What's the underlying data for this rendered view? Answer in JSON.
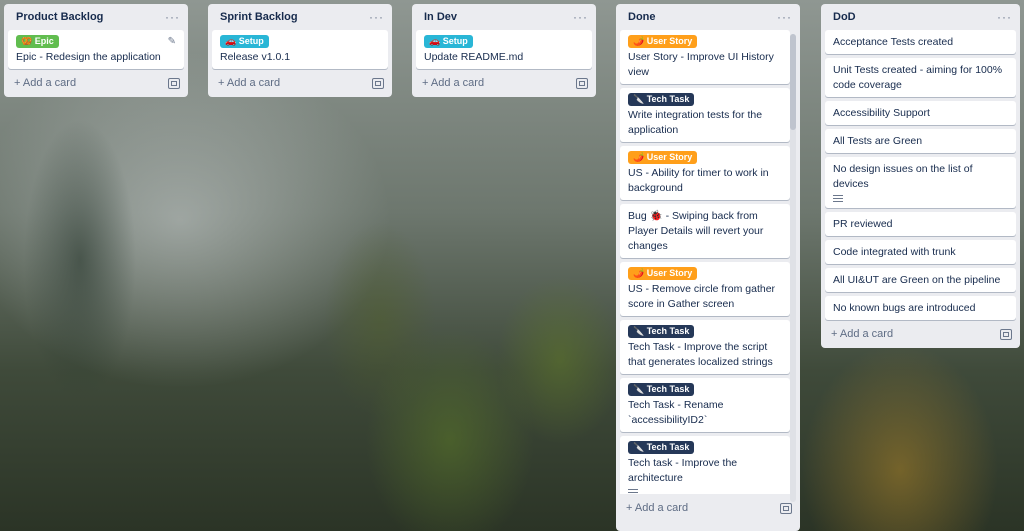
{
  "add_card_label": "Add a card",
  "menu_glyph": "···",
  "lists": [
    {
      "title": "Product Backlog",
      "cards": [
        {
          "label": "🥨 Epic",
          "title": "Epic - Redesign the application"
        }
      ]
    },
    {
      "title": "Sprint Backlog",
      "cards": [
        {
          "label": "🚗 Setup",
          "title": "Release v1.0.1"
        }
      ]
    },
    {
      "title": "In Dev",
      "cards": [
        {
          "label": "🚗 Setup",
          "title": "Update README.md"
        }
      ]
    },
    {
      "title": "Done",
      "cards": [
        {
          "label": "🌶️ User Story",
          "title": "User Story - Improve UI History view"
        },
        {
          "label": "🔪 Tech Task",
          "title": "Write integration tests for the application"
        },
        {
          "label": "🌶️ User Story",
          "title": "US - Ability for timer to work in background"
        },
        {
          "label": "",
          "title": "Bug 🐞 - Swiping back from Player Details will revert your changes"
        },
        {
          "label": "🌶️ User Story",
          "title": "US - Remove circle from gather score in Gather screen"
        },
        {
          "label": "🔪 Tech Task",
          "title": "Tech Task - Improve the script that generates localized strings"
        },
        {
          "label": "🔪 Tech Task",
          "title": "Tech Task - Rename `accessibilityID2`"
        },
        {
          "label": "🔪 Tech Task",
          "title": "Tech task - Improve the architecture"
        }
      ]
    },
    {
      "title": "DoD",
      "cards": [
        {
          "title": "Acceptance Tests created"
        },
        {
          "title": "Unit Tests created - aiming for 100% code coverage"
        },
        {
          "title": "Accessibility Support"
        },
        {
          "title": "All Tests are Green"
        },
        {
          "title": "No design issues on the list of devices"
        },
        {
          "title": "PR reviewed"
        },
        {
          "title": "Code integrated with trunk"
        },
        {
          "title": "All UI&UT are Green on the pipeline"
        },
        {
          "title": "No known bugs are introduced"
        }
      ]
    }
  ],
  "colors": {
    "label_epic": "#61bd4f",
    "label_setup": "#29b6d6",
    "label_user_story": "#ff9f1a",
    "label_tech_task": "#253858"
  }
}
